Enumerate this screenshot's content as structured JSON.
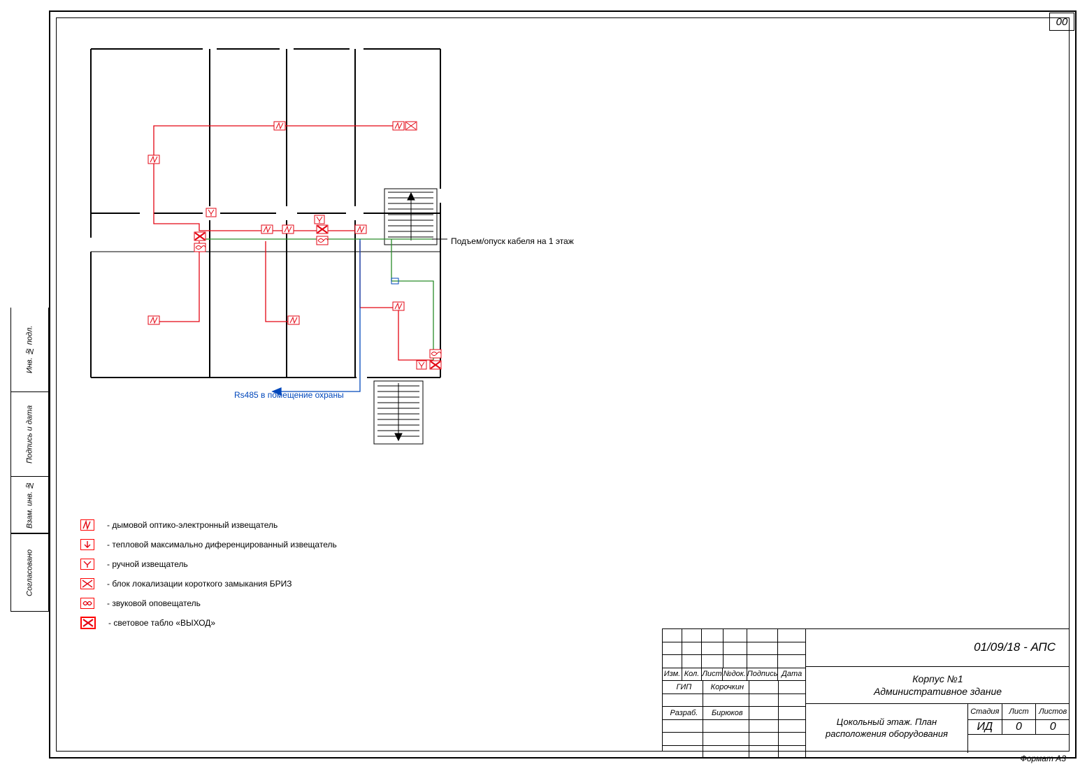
{
  "page_number": "00",
  "format_label": "Формат А3",
  "side_stamp": {
    "agreed": "Согласовано",
    "vz_inv": "Взам. инв. №",
    "sign_date": "Подпись и дата",
    "inv_podl": "Инв. № подл."
  },
  "titleblock": {
    "cols": {
      "izm": "Изм.",
      "kol": "Кол.",
      "list": "Лист",
      "ndok": "№док.",
      "podp": "Подпись",
      "data": "Дата"
    },
    "roles": {
      "gip": "ГИП",
      "razrab": "Разраб."
    },
    "names": {
      "gip": "Корочкин",
      "razrab": "Бирюков"
    },
    "project_code": "01/09/18 - АПС",
    "object_line1": "Корпус №1",
    "object_line2": "Административное здание",
    "sheet_title_line1": "Цокольный этаж. План",
    "sheet_title_line2": "расположения оборудования",
    "col_stadiya": "Стадия",
    "col_list": "Лист",
    "col_listov": "Листов",
    "val_stadiya": "ИД",
    "val_list": "0",
    "val_listov": "0"
  },
  "annotations": {
    "cable_riser": "Подъем/опуск кабеля на 1 этаж",
    "rs485": "Rs485 в помещение охраны"
  },
  "legend": [
    {
      "id": "smoke-detector",
      "symbol": "zigzag",
      "text": "- дымовой оптико-электронный извещатель"
    },
    {
      "id": "heat-detector",
      "symbol": "arrow-down",
      "text": "- тепловой максимально диференцированный извещатель"
    },
    {
      "id": "manual-callpoint",
      "symbol": "y",
      "text": "- ручной извещатель"
    },
    {
      "id": "briz-isolator",
      "symbol": "x",
      "text": "- блок локализации короткого замыкания БРИЗ"
    },
    {
      "id": "sounder",
      "symbol": "sounder",
      "text": "- звуковой оповещатель"
    },
    {
      "id": "exit-sign",
      "symbol": "x-bold",
      "text": "- световое табло «ВЫХОД»"
    }
  ],
  "colors": {
    "red": "#e30613",
    "blue": "#0047bb",
    "green": "#2a8c2a",
    "black": "#000"
  }
}
